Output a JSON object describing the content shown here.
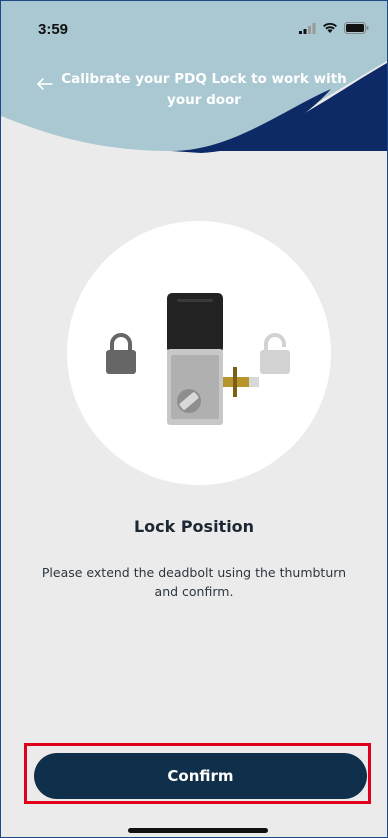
{
  "status_bar": {
    "time": "3:59"
  },
  "header": {
    "title": "Calibrate your PDQ Lock to work with your door"
  },
  "main": {
    "heading": "Lock Position",
    "description": "Please extend the deadbolt using the thumbturn and confirm.",
    "icons": {
      "left": "locked-padlock-icon",
      "right": "unlocked-padlock-icon"
    }
  },
  "footer": {
    "confirm_label": "Confirm"
  },
  "colors": {
    "background": "#ebebeb",
    "header_light": "#a9c8d1",
    "header_dark": "#0e2a66",
    "button": "#0f2f4a",
    "highlight": "#e0001b"
  }
}
